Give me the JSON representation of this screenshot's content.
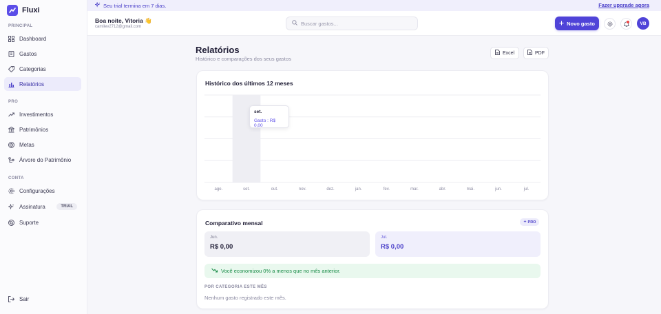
{
  "app": {
    "name": "Fluxi"
  },
  "sidebar": {
    "sections": [
      {
        "label": "PRINCIPAL"
      },
      {
        "label": "PRO"
      },
      {
        "label": "CONTA"
      }
    ],
    "items": [
      {
        "label": "Dashboard",
        "icon": "grid-icon"
      },
      {
        "label": "Gastos",
        "icon": "receipt-icon"
      },
      {
        "label": "Categorias",
        "icon": "tag-icon"
      },
      {
        "label": "Relatórios",
        "icon": "bar-chart-icon",
        "active": true
      },
      {
        "label": "Investimentos",
        "icon": "trend-up-icon"
      },
      {
        "label": "Patrimônios",
        "icon": "bank-icon"
      },
      {
        "label": "Metas",
        "icon": "target-icon"
      },
      {
        "label": "Árvore do Patrimônio",
        "icon": "tree-icon"
      },
      {
        "label": "Configurações",
        "icon": "gear-icon"
      },
      {
        "label": "Assinatura",
        "icon": "sparkle-icon",
        "badge": "TRIAL"
      },
      {
        "label": "Suporte",
        "icon": "lifebuoy-icon"
      }
    ],
    "logout": "Sair"
  },
  "banner": {
    "text": "Seu trial termina em 7 dias.",
    "link": "Fazer upgrade agora"
  },
  "header": {
    "greeting": "Boa noite, Vitoria 👋",
    "email": "camilev2712@gmail.com",
    "search_placeholder": "Buscar gastos...",
    "new_button": "Novo gasto",
    "avatar_initials": "VB"
  },
  "page": {
    "title": "Relatórios",
    "subtitle": "Histórico e comparações dos seus gastos",
    "export_excel": "Excel",
    "export_pdf": "PDF"
  },
  "history": {
    "title": "Histórico dos últimos 12 meses",
    "tooltip": {
      "month": "set.",
      "text": "Gasto : R$ 0,00"
    }
  },
  "chart_data": {
    "type": "bar",
    "title": "Histórico dos últimos 12 meses",
    "categories": [
      "ago.",
      "set.",
      "out.",
      "nov.",
      "dez.",
      "jan.",
      "fev.",
      "mar.",
      "abr.",
      "mai.",
      "jun.",
      "jul."
    ],
    "series": [
      {
        "name": "Gasto",
        "values": [
          0,
          0,
          0,
          0,
          0,
          0,
          0,
          0,
          0,
          0,
          0,
          0
        ]
      }
    ],
    "highlighted_category": "set.",
    "grid": true,
    "colors": {
      "highlight": "#eeeef3",
      "grid": "#eeeef2"
    }
  },
  "comparison": {
    "title": "Comparativo mensal",
    "badge": "PRO",
    "previous": {
      "month": "Jun.",
      "value": "R$ 0,00"
    },
    "current": {
      "month": "Jul.",
      "value": "R$ 0,00"
    },
    "savings_text": "Você economizou 0% a menos que no mês anterior.",
    "category_label": "POR CATEGORIA ESTE MÊS",
    "category_empty": "Nenhum gasto registrado este mês."
  },
  "colors": {
    "accent": "#4f43d8",
    "success": "#168a45",
    "success_bg": "#e9f8ee"
  }
}
